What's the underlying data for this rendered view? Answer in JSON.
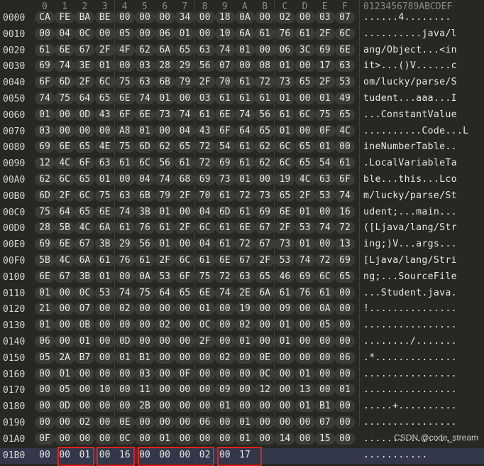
{
  "header": {
    "cols": [
      "0",
      "1",
      "2",
      "3",
      "4",
      "5",
      "6",
      "7",
      "8",
      "9",
      "A",
      "B",
      "C",
      "D",
      "E",
      "F"
    ],
    "ascii_header": "0123456789ABCDEF"
  },
  "rows": [
    {
      "off": "0000",
      "b": [
        "CA",
        "FE",
        "BA",
        "BE",
        "00",
        "00",
        "00",
        "34",
        "00",
        "18",
        "0A",
        "00",
        "02",
        "00",
        "03",
        "07"
      ],
      "a": "......4........"
    },
    {
      "off": "0010",
      "b": [
        "00",
        "04",
        "0C",
        "00",
        "05",
        "00",
        "06",
        "01",
        "00",
        "10",
        "6A",
        "61",
        "76",
        "61",
        "2F",
        "6C"
      ],
      "a": "..........java/l"
    },
    {
      "off": "0020",
      "b": [
        "61",
        "6E",
        "67",
        "2F",
        "4F",
        "62",
        "6A",
        "65",
        "63",
        "74",
        "01",
        "00",
        "06",
        "3C",
        "69",
        "6E"
      ],
      "a": "ang/Object...<in"
    },
    {
      "off": "0030",
      "b": [
        "69",
        "74",
        "3E",
        "01",
        "00",
        "03",
        "28",
        "29",
        "56",
        "07",
        "00",
        "08",
        "01",
        "00",
        "17",
        "63"
      ],
      "a": "it>...()V......c"
    },
    {
      "off": "0040",
      "b": [
        "6F",
        "6D",
        "2F",
        "6C",
        "75",
        "63",
        "6B",
        "79",
        "2F",
        "70",
        "61",
        "72",
        "73",
        "65",
        "2F",
        "53"
      ],
      "a": "om/lucky/parse/S"
    },
    {
      "off": "0050",
      "b": [
        "74",
        "75",
        "64",
        "65",
        "6E",
        "74",
        "01",
        "00",
        "03",
        "61",
        "61",
        "61",
        "01",
        "00",
        "01",
        "49"
      ],
      "a": "tudent...aaa...I"
    },
    {
      "off": "0060",
      "b": [
        "01",
        "00",
        "0D",
        "43",
        "6F",
        "6E",
        "73",
        "74",
        "61",
        "6E",
        "74",
        "56",
        "61",
        "6C",
        "75",
        "65"
      ],
      "a": "...ConstantValue"
    },
    {
      "off": "0070",
      "b": [
        "03",
        "00",
        "00",
        "00",
        "A8",
        "01",
        "00",
        "04",
        "43",
        "6F",
        "64",
        "65",
        "01",
        "00",
        "0F",
        "4C"
      ],
      "a": "..........Code...L"
    },
    {
      "off": "0080",
      "b": [
        "69",
        "6E",
        "65",
        "4E",
        "75",
        "6D",
        "62",
        "65",
        "72",
        "54",
        "61",
        "62",
        "6C",
        "65",
        "01",
        "00"
      ],
      "a": "ineNumberTable.."
    },
    {
      "off": "0090",
      "b": [
        "12",
        "4C",
        "6F",
        "63",
        "61",
        "6C",
        "56",
        "61",
        "72",
        "69",
        "61",
        "62",
        "6C",
        "65",
        "54",
        "61"
      ],
      "a": ".LocalVariableTa"
    },
    {
      "off": "00A0",
      "b": [
        "62",
        "6C",
        "65",
        "01",
        "00",
        "04",
        "74",
        "68",
        "69",
        "73",
        "01",
        "00",
        "19",
        "4C",
        "63",
        "6F"
      ],
      "a": "ble...this...Lco"
    },
    {
      "off": "00B0",
      "b": [
        "6D",
        "2F",
        "6C",
        "75",
        "63",
        "6B",
        "79",
        "2F",
        "70",
        "61",
        "72",
        "73",
        "65",
        "2F",
        "53",
        "74"
      ],
      "a": "m/lucky/parse/St"
    },
    {
      "off": "00C0",
      "b": [
        "75",
        "64",
        "65",
        "6E",
        "74",
        "3B",
        "01",
        "00",
        "04",
        "6D",
        "61",
        "69",
        "6E",
        "01",
        "00",
        "16"
      ],
      "a": "udent;...main..."
    },
    {
      "off": "00D0",
      "b": [
        "28",
        "5B",
        "4C",
        "6A",
        "61",
        "76",
        "61",
        "2F",
        "6C",
        "61",
        "6E",
        "67",
        "2F",
        "53",
        "74",
        "72"
      ],
      "a": "([Ljava/lang/Str"
    },
    {
      "off": "00E0",
      "b": [
        "69",
        "6E",
        "67",
        "3B",
        "29",
        "56",
        "01",
        "00",
        "04",
        "61",
        "72",
        "67",
        "73",
        "01",
        "00",
        "13"
      ],
      "a": "ing;)V...args..."
    },
    {
      "off": "00F0",
      "b": [
        "5B",
        "4C",
        "6A",
        "61",
        "76",
        "61",
        "2F",
        "6C",
        "61",
        "6E",
        "67",
        "2F",
        "53",
        "74",
        "72",
        "69"
      ],
      "a": "[Ljava/lang/Stri"
    },
    {
      "off": "0100",
      "b": [
        "6E",
        "67",
        "3B",
        "01",
        "00",
        "0A",
        "53",
        "6F",
        "75",
        "72",
        "63",
        "65",
        "46",
        "69",
        "6C",
        "65"
      ],
      "a": "ng;...SourceFile"
    },
    {
      "off": "0110",
      "b": [
        "01",
        "00",
        "0C",
        "53",
        "74",
        "75",
        "64",
        "65",
        "6E",
        "74",
        "2E",
        "6A",
        "61",
        "76",
        "61",
        "00"
      ],
      "a": "...Student.java."
    },
    {
      "off": "0120",
      "b": [
        "21",
        "00",
        "07",
        "00",
        "02",
        "00",
        "00",
        "00",
        "01",
        "00",
        "19",
        "00",
        "09",
        "00",
        "0A",
        "00"
      ],
      "a": "!..............."
    },
    {
      "off": "0130",
      "b": [
        "01",
        "00",
        "0B",
        "00",
        "00",
        "00",
        "02",
        "00",
        "0C",
        "00",
        "02",
        "00",
        "01",
        "00",
        "05",
        "00"
      ],
      "a": "................"
    },
    {
      "off": "0140",
      "b": [
        "06",
        "00",
        "01",
        "00",
        "0D",
        "00",
        "00",
        "00",
        "2F",
        "00",
        "01",
        "00",
        "01",
        "00",
        "00",
        "00"
      ],
      "a": "......../......."
    },
    {
      "off": "0150",
      "b": [
        "05",
        "2A",
        "B7",
        "00",
        "01",
        "B1",
        "00",
        "00",
        "00",
        "02",
        "00",
        "0E",
        "00",
        "00",
        "00",
        "06"
      ],
      "a": ".*.............."
    },
    {
      "off": "0160",
      "b": [
        "00",
        "01",
        "00",
        "00",
        "00",
        "03",
        "00",
        "0F",
        "00",
        "00",
        "00",
        "0C",
        "00",
        "01",
        "00",
        "00"
      ],
      "a": "................"
    },
    {
      "off": "0170",
      "b": [
        "00",
        "05",
        "00",
        "10",
        "00",
        "11",
        "00",
        "00",
        "00",
        "09",
        "00",
        "12",
        "00",
        "13",
        "00",
        "01"
      ],
      "a": "................"
    },
    {
      "off": "0180",
      "b": [
        "00",
        "0D",
        "00",
        "00",
        "00",
        "2B",
        "00",
        "00",
        "00",
        "01",
        "00",
        "00",
        "00",
        "01",
        "B1",
        "00"
      ],
      "a": ".....+.........."
    },
    {
      "off": "0190",
      "b": [
        "00",
        "00",
        "02",
        "00",
        "0E",
        "00",
        "00",
        "00",
        "06",
        "00",
        "01",
        "00",
        "00",
        "00",
        "07",
        "00"
      ],
      "a": "................"
    },
    {
      "off": "01A0",
      "b": [
        "0F",
        "00",
        "00",
        "00",
        "0C",
        "00",
        "01",
        "00",
        "00",
        "00",
        "01",
        "00",
        "14",
        "00",
        "15",
        "00"
      ],
      "a": "................"
    },
    {
      "off": "01B0",
      "b": [
        "00",
        "00",
        "01",
        "00",
        "16",
        "00",
        "00",
        "00",
        "02",
        "00",
        "17"
      ],
      "a": "..........."
    }
  ],
  "watermark": "CSDN @code_stream"
}
